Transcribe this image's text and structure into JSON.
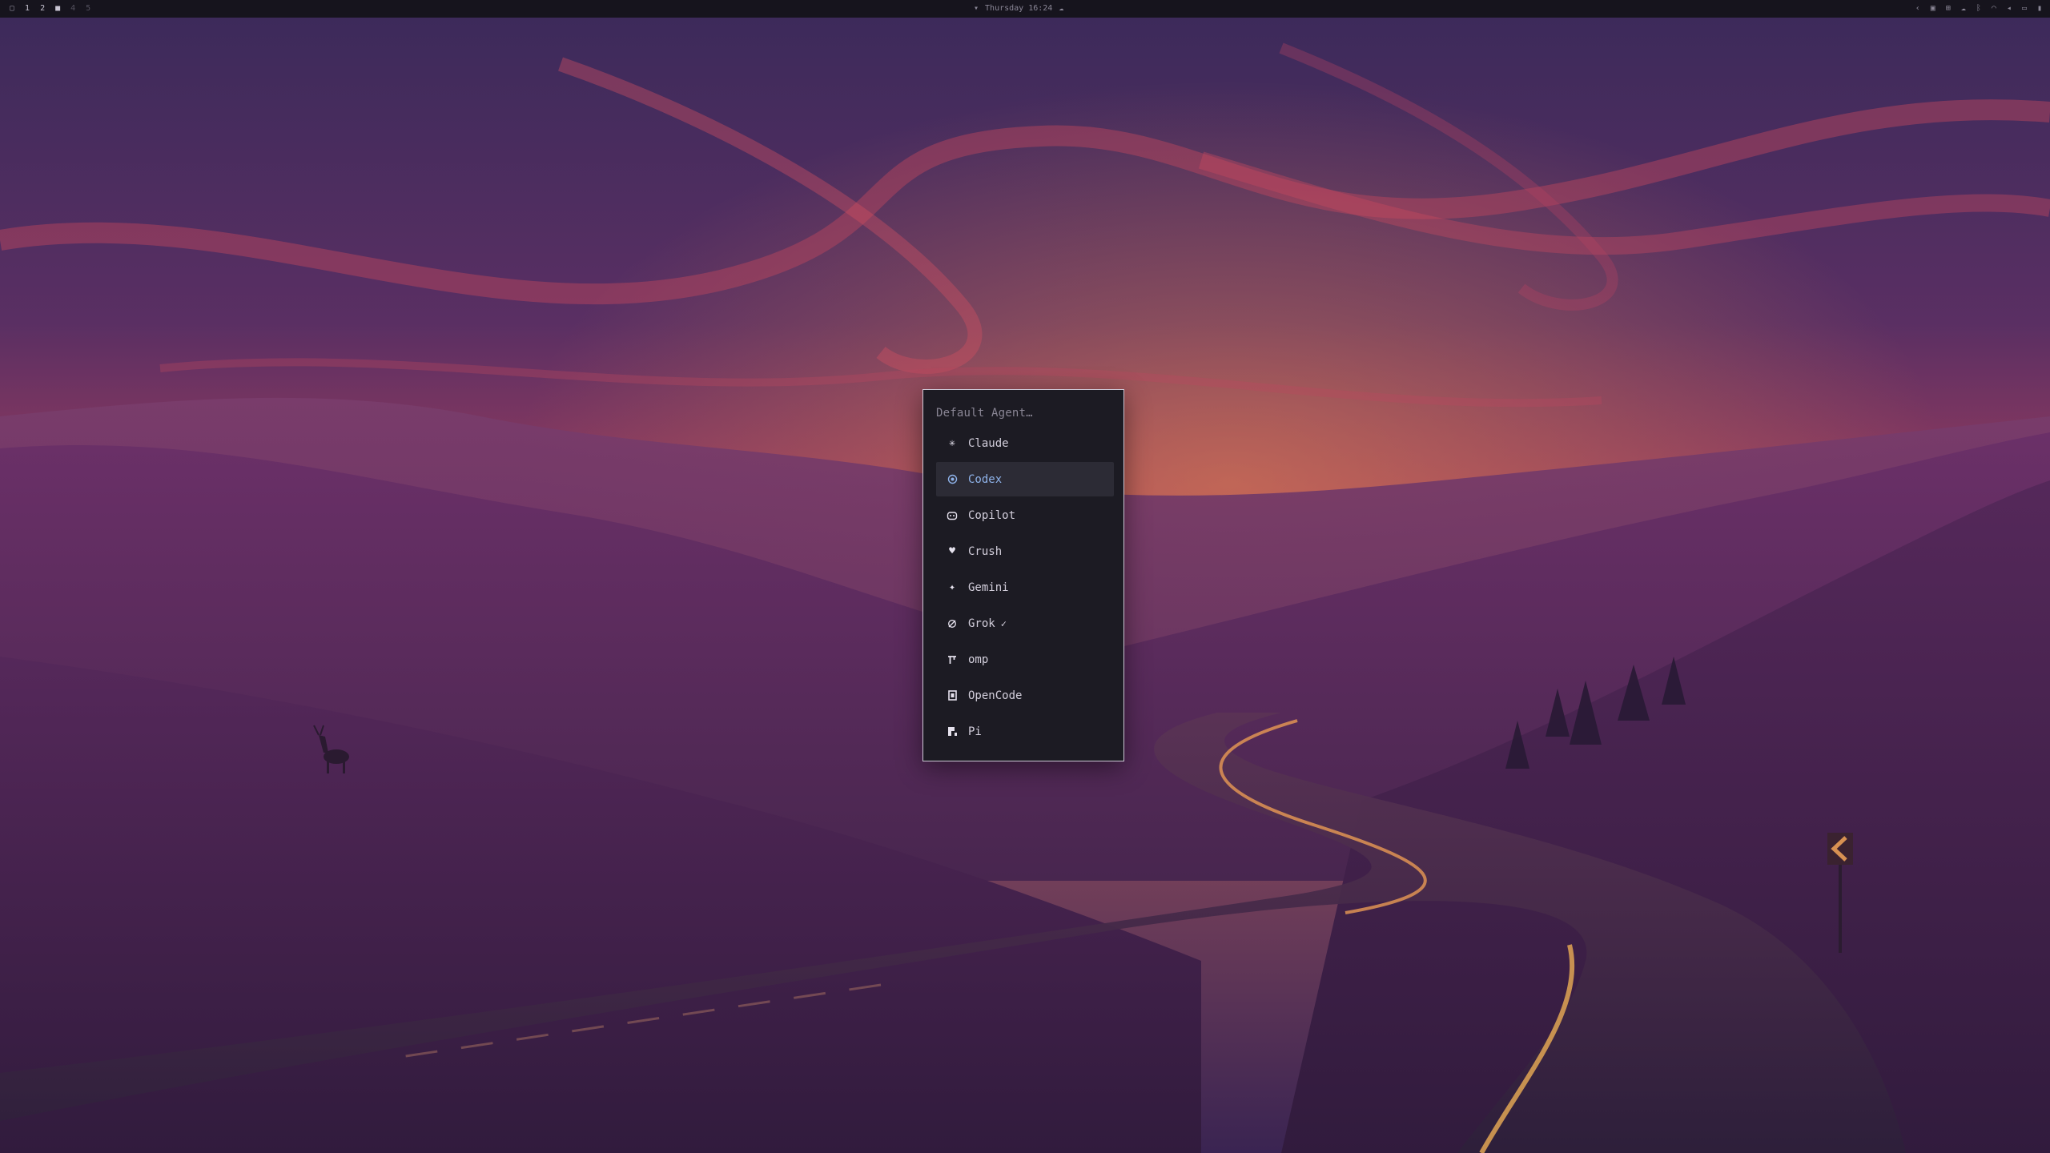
{
  "topbar": {
    "workspaces": [
      {
        "label": "1",
        "state": "normal"
      },
      {
        "label": "2",
        "state": "normal"
      },
      {
        "label": "4",
        "state": "dim"
      },
      {
        "label": "5",
        "state": "dim"
      }
    ],
    "clock": "Thursday 16:24",
    "accent": "#c9c5d3"
  },
  "menu": {
    "prompt": "Default Agent…",
    "selected_color": "#8fb3ea",
    "items": [
      {
        "label": "Claude",
        "icon": "asterisk-icon"
      },
      {
        "label": "Codex",
        "icon": "codex-icon",
        "selected": true
      },
      {
        "label": "Copilot",
        "icon": "copilot-icon"
      },
      {
        "label": "Crush",
        "icon": "heart-icon"
      },
      {
        "label": "Gemini",
        "icon": "sparkle-icon"
      },
      {
        "label": "Grok",
        "icon": "grok-icon",
        "check": "✓"
      },
      {
        "label": "omp",
        "icon": "omp-icon"
      },
      {
        "label": "OpenCode",
        "icon": "opencode-icon"
      },
      {
        "label": "Pi",
        "icon": "pi-icon"
      }
    ]
  }
}
